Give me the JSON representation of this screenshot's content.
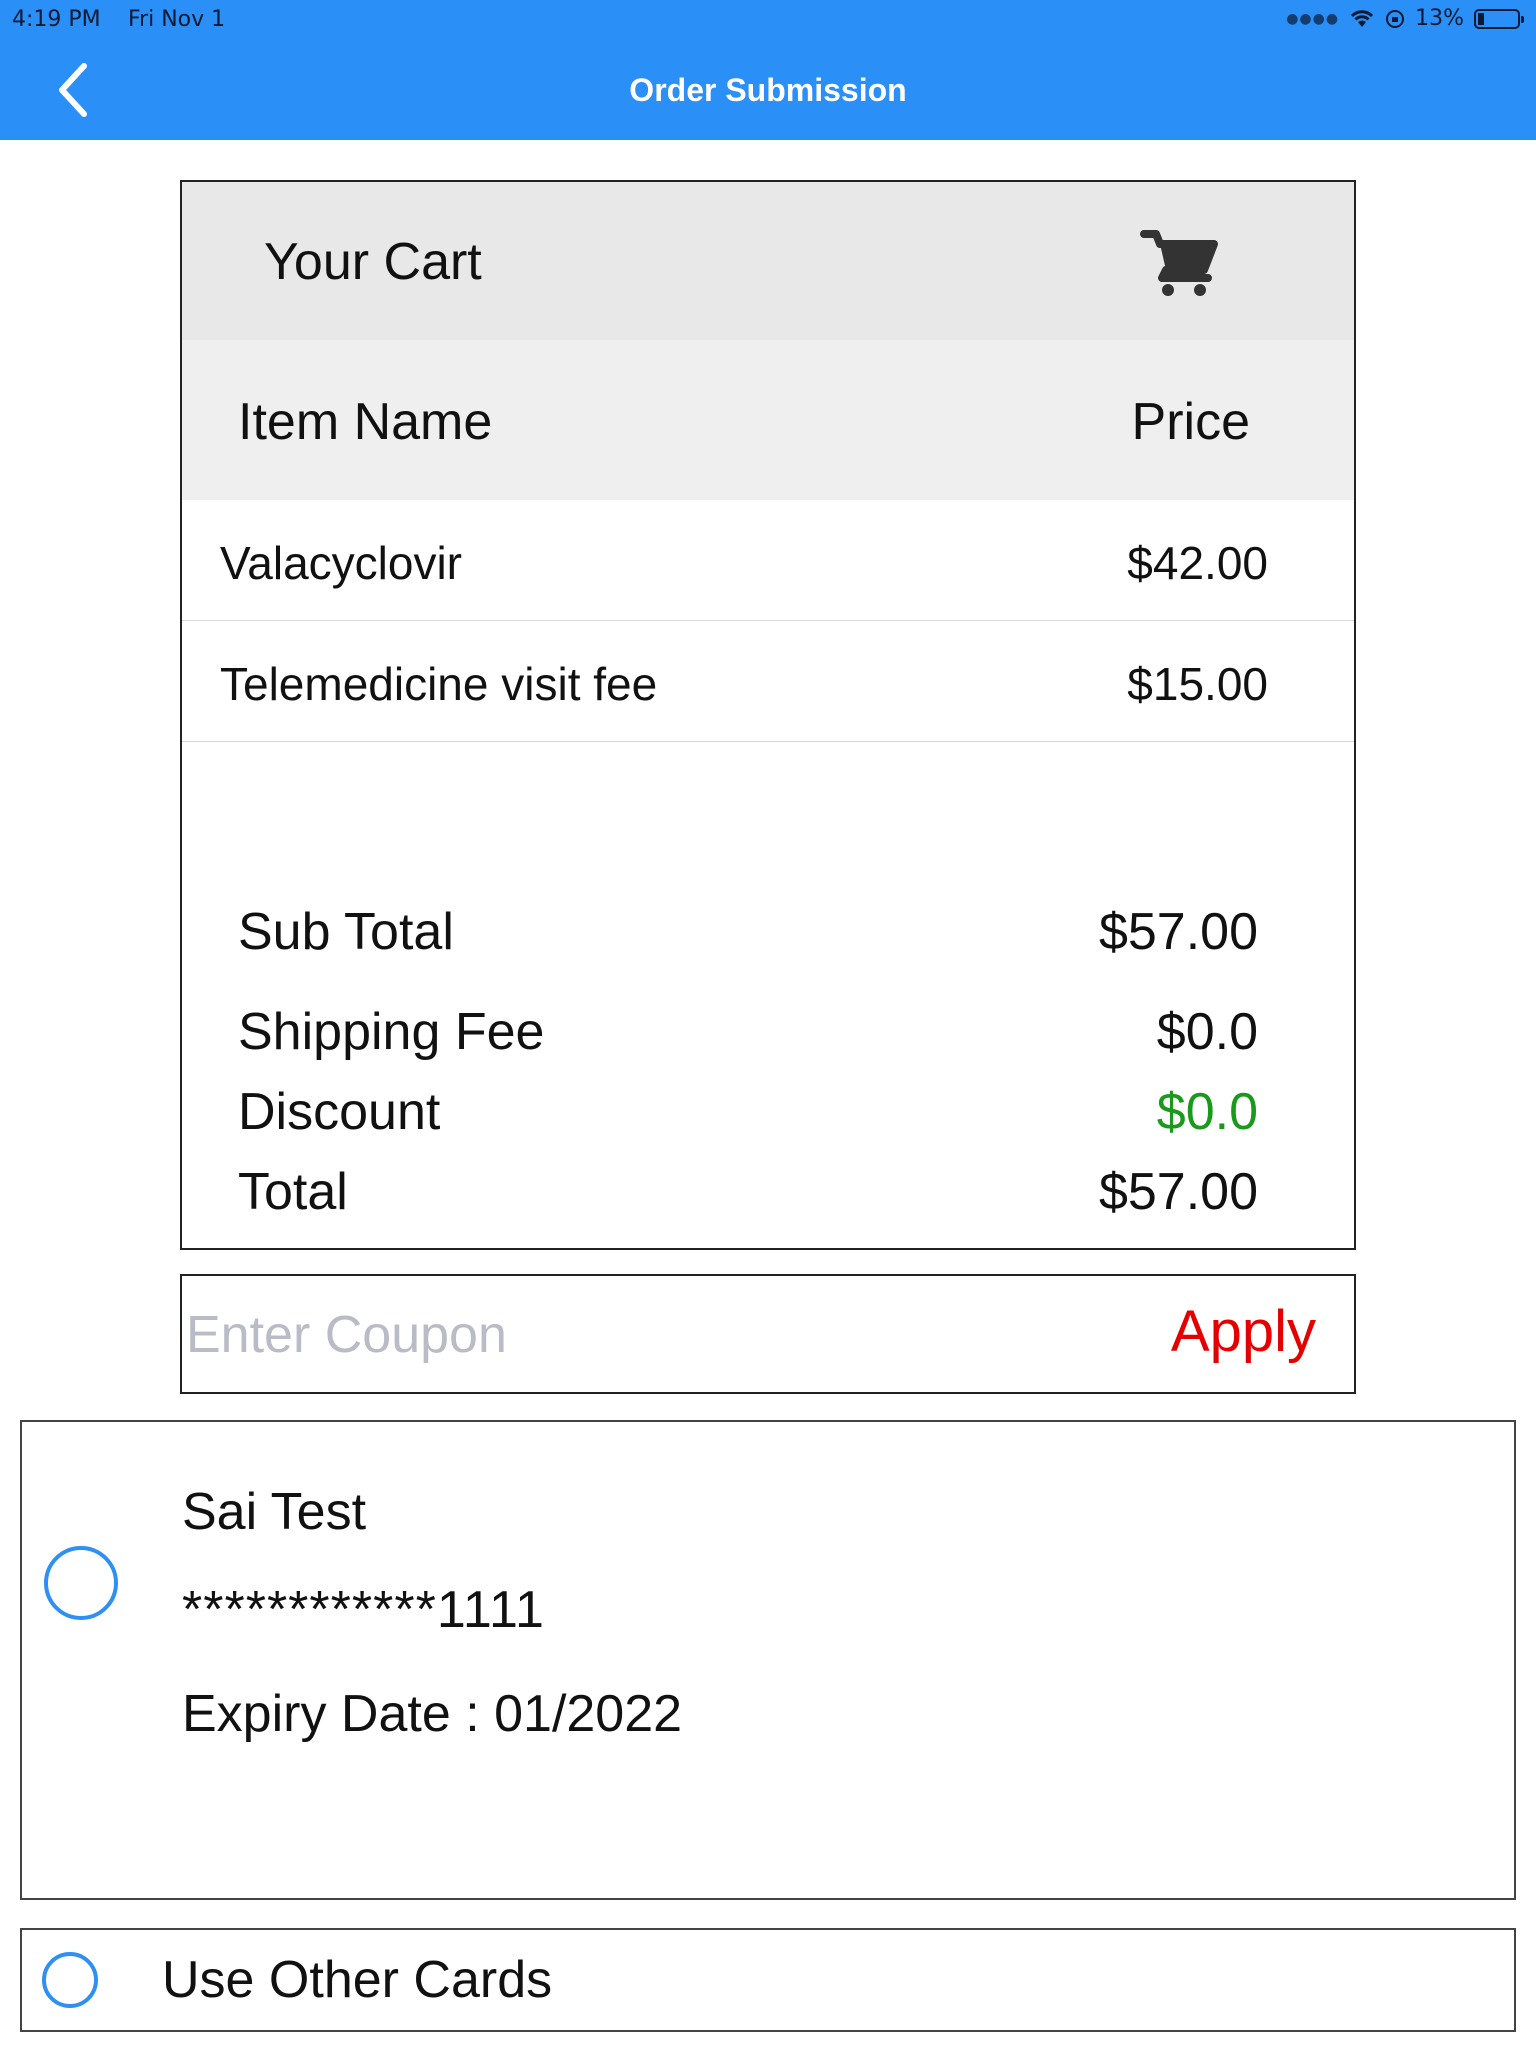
{
  "status_bar": {
    "time": "4:19 PM",
    "date": "Fri Nov 1",
    "battery": "13%"
  },
  "nav": {
    "title": "Order Submission",
    "back_icon": "chevron-left-icon"
  },
  "cart": {
    "title": "Your Cart",
    "icon": "cart-icon",
    "columns": {
      "name": "Item Name",
      "price": "Price"
    },
    "items": [
      {
        "name": "Valacyclovir",
        "price": "$42.00"
      },
      {
        "name": "Telemedicine visit fee",
        "price": "$15.00"
      }
    ],
    "summary": {
      "subtotal_label": "Sub Total",
      "subtotal_value": "$57.00",
      "shipping_label": "Shipping Fee",
      "shipping_value": "$0.0",
      "discount_label": "Discount",
      "discount_value": "$0.0",
      "total_label": "Total",
      "total_value": "$57.00"
    }
  },
  "coupon": {
    "placeholder": "Enter Coupon",
    "value": "",
    "apply_label": "Apply"
  },
  "payment": {
    "saved_card": {
      "holder": "Sai Test",
      "number": "************1111",
      "expiry": "Expiry Date : 01/2022",
      "selected": false
    },
    "other_cards_label": "Use Other Cards"
  },
  "colors": {
    "brand_blue": "#2a8ff7",
    "radio_blue": "#2e8ff5",
    "apply_red": "#e50000",
    "discount_green": "#1a9a1a"
  }
}
